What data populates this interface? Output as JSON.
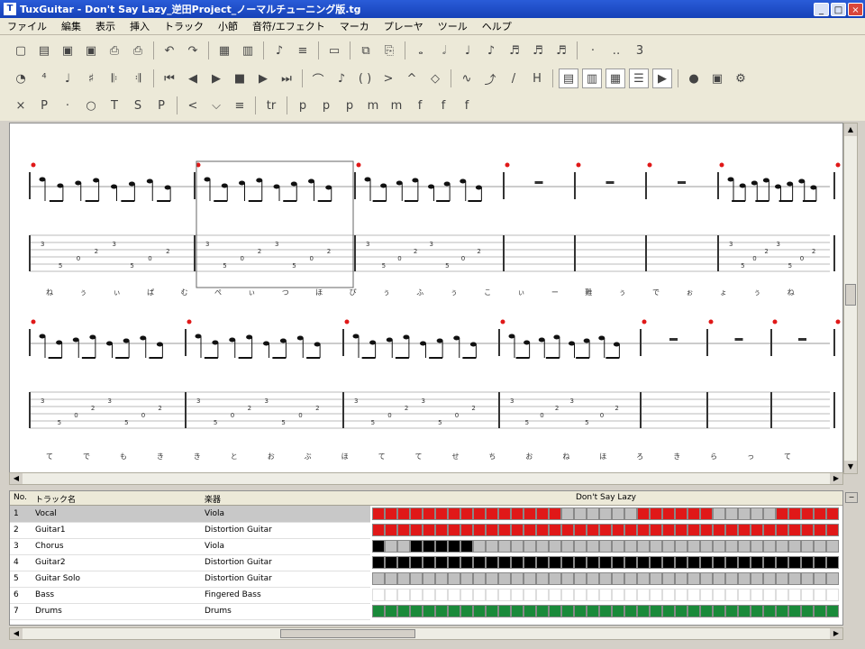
{
  "window": {
    "title": "TuxGuitar - Don't Say Lazy_逆田Project_ノーマルチューニング版.tg",
    "app_icon": "tuxguitar-icon",
    "minimize": "_",
    "maximize": "□",
    "close": "×"
  },
  "menu": [
    "ファイル",
    "編集",
    "表示",
    "挿入",
    "トラック",
    "小節",
    "音符/エフェクト",
    "マーカ",
    "プレーヤ",
    "ツール",
    "ヘルプ"
  ],
  "toolbar_icons": {
    "row1": [
      "new-icon",
      "open-icon",
      "save-icon",
      "save-as-icon",
      "print-icon",
      "print-preview-icon",
      "sep",
      "undo-icon",
      "redo-icon",
      "sep",
      "page-view-icon",
      "linear-view-icon",
      "sep",
      "score-icon",
      "tab-icon",
      "sep",
      "compact-icon",
      "sep",
      "copy-icon",
      "paste-icon",
      "sep",
      "whole-note-icon",
      "half-note-icon",
      "quarter-note-icon",
      "eighth-note-icon",
      "sixteenth-note-icon",
      "thirty-second-note-icon",
      "sixty-fourth-note-icon",
      "sep",
      "dotted-icon",
      "double-dotted-icon",
      "triplet-icon"
    ],
    "row2": [
      "metronome-icon",
      "time-signature-icon",
      "tempo-icon",
      "key-signature-icon",
      "repeat-open-icon",
      "repeat-close-icon",
      "sep",
      "first-measure-icon",
      "previous-measure-icon",
      "play-icon",
      "stop-icon",
      "next-measure-icon",
      "last-measure-icon",
      "sep",
      "tie-icon",
      "grace-icon",
      "ghost-icon",
      "accent-icon",
      "heavy-accent-icon",
      "harmonic-icon",
      "sep",
      "vibrato-icon",
      "bend-icon",
      "slide-icon",
      "hammer-icon",
      "sep",
      "fretboard-icon",
      "piano-icon",
      "matrix-icon",
      "mixer-icon",
      "transport-icon",
      "sep",
      "mic-icon",
      "camera-icon",
      "settings-icon"
    ],
    "row3": [
      "dead-note-icon",
      "palm-mute-icon",
      "staccato-icon",
      "let-ring-icon",
      "tapping-icon",
      "slapping-icon",
      "popping-icon",
      "sep",
      "fade-in-icon",
      "tremolo-bar-icon",
      "tremolo-picking-icon",
      "sep",
      "trill-icon",
      "sep",
      "dynamic-ppp-icon",
      "dynamic-pp-icon",
      "dynamic-p-icon",
      "dynamic-mp-icon",
      "dynamic-mf-icon",
      "dynamic-f-icon",
      "dynamic-ff-icon",
      "dynamic-fff-icon"
    ],
    "row1_active": [],
    "row2_active": [
      "fretboard-icon",
      "piano-icon",
      "matrix-icon",
      "mixer-icon",
      "transport-icon"
    ]
  },
  "score": {
    "staff1_lyrics": [
      "ね",
      "ぅ",
      "ぃ",
      "ぱ",
      "む",
      "ぺ",
      "ぃ",
      "つ",
      "ほ",
      "ぴ",
      "ぅ",
      "ふ",
      "ぅ",
      "こ",
      "ぃ",
      "ー",
      "難",
      "ぅ",
      "で",
      "ぉ",
      "ょ",
      "ぅ",
      "ね"
    ],
    "staff2_lyrics": [
      "て",
      "で",
      "も",
      "き",
      "き",
      "と",
      "お",
      "ぶ",
      "ほ",
      "て",
      "て",
      "せ",
      "ち",
      "お",
      "ね",
      "ほ",
      "ろ",
      "き",
      "ら",
      "っ",
      "て"
    ]
  },
  "tracks": {
    "header": {
      "no": "No.",
      "name": "トラック名",
      "instrument": "楽器",
      "song": "Don't Say Lazy"
    },
    "rows": [
      {
        "no": "1",
        "name": "Vocal",
        "instrument": "Viola",
        "selected": true
      },
      {
        "no": "2",
        "name": "Guitar1",
        "instrument": "Distortion Guitar",
        "selected": false
      },
      {
        "no": "3",
        "name": "Chorus",
        "instrument": "Viola",
        "selected": false
      },
      {
        "no": "4",
        "name": "Guitar2",
        "instrument": "Distortion Guitar",
        "selected": false
      },
      {
        "no": "5",
        "name": "Guitar Solo",
        "instrument": "Distortion Guitar",
        "selected": false
      },
      {
        "no": "6",
        "name": "Bass",
        "instrument": "Fingered Bass",
        "selected": false
      },
      {
        "no": "7",
        "name": "Drums",
        "instrument": "Drums",
        "selected": false
      }
    ]
  },
  "colors": {
    "title_bar": "#1541b8",
    "vocal_track": "#e01818",
    "guitar_track": "#000000",
    "drums_track": "#1a8a3a",
    "empty_measure": "#c0c0c0",
    "measure_number": "#e01818"
  }
}
